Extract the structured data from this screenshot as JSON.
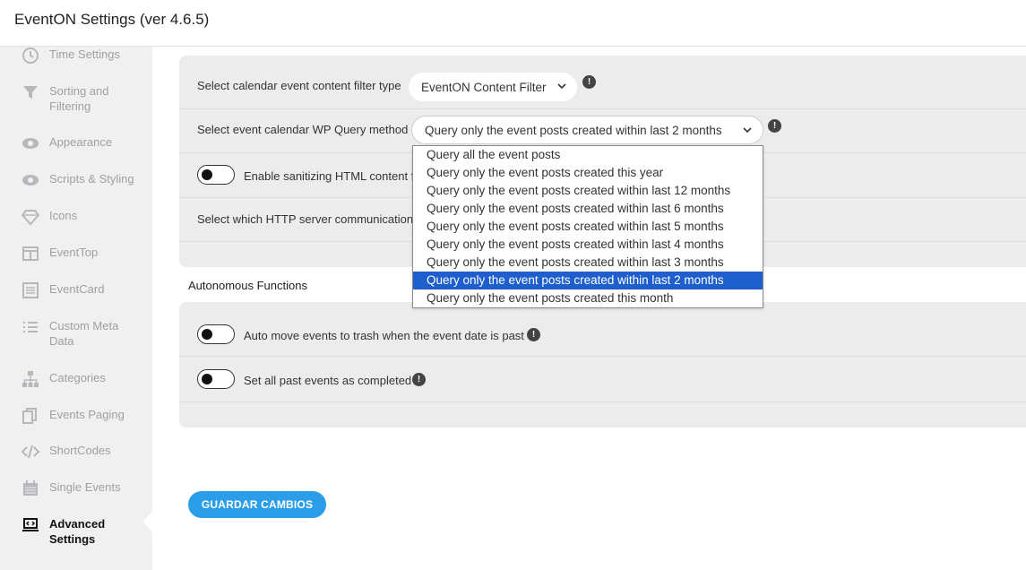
{
  "header": {
    "title": "EventON Settings (ver 4.6.5)"
  },
  "sidebar": {
    "items": [
      {
        "label": "Time Settings",
        "icon": "clock-icon"
      },
      {
        "label": "Sorting and Filtering",
        "icon": "filter-icon"
      },
      {
        "label": "Appearance",
        "icon": "eye-icon"
      },
      {
        "label": "Scripts & Styling",
        "icon": "eye-icon"
      },
      {
        "label": "Icons",
        "icon": "diamond-icon"
      },
      {
        "label": "EventTop",
        "icon": "columns-icon"
      },
      {
        "label": "EventCard",
        "icon": "list-box-icon"
      },
      {
        "label": "Custom Meta Data",
        "icon": "list-icon"
      },
      {
        "label": "Categories",
        "icon": "sitemap-icon"
      },
      {
        "label": "Events Paging",
        "icon": "copy-icon"
      },
      {
        "label": "ShortCodes",
        "icon": "code-icon"
      },
      {
        "label": "Single Events",
        "icon": "calendar-icon"
      },
      {
        "label": "Advanced Settings",
        "icon": "laptop-code-icon"
      }
    ],
    "active": "Advanced Settings"
  },
  "content_filter": {
    "label": "Select calendar event content filter type",
    "value": "EventON Content Filter"
  },
  "query_method": {
    "label": "Select event calendar WP Query method",
    "value": "Query only the event posts created within last 2 months",
    "options": [
      "Query all the event posts",
      "Query only the event posts created this year",
      "Query only the event posts created within last 12 months",
      "Query only the event posts created within last 6 months",
      "Query only the event posts created within last 5 months",
      "Query only the event posts created within last 4 months",
      "Query only the event posts created within last 3 months",
      "Query only the event posts created within last 2 months",
      "Query only the event posts created this month"
    ],
    "selected_index": 7
  },
  "sanitize": {
    "label": "Enable sanitizing HTML content f"
  },
  "http_method": {
    "label": "Select which HTTP server communication"
  },
  "autonomous": {
    "title": "Autonomous Functions",
    "trash_label": "Auto move events to trash when the event date is past",
    "completed_label": "Set all past events as completed"
  },
  "save_button": {
    "label": "GUARDAR CAMBIOS"
  },
  "colors": {
    "accent": "#2c9ee9",
    "selected_option": "#1f5fcd",
    "panel": "#ececec",
    "sidebar": "#f0f0f1"
  }
}
